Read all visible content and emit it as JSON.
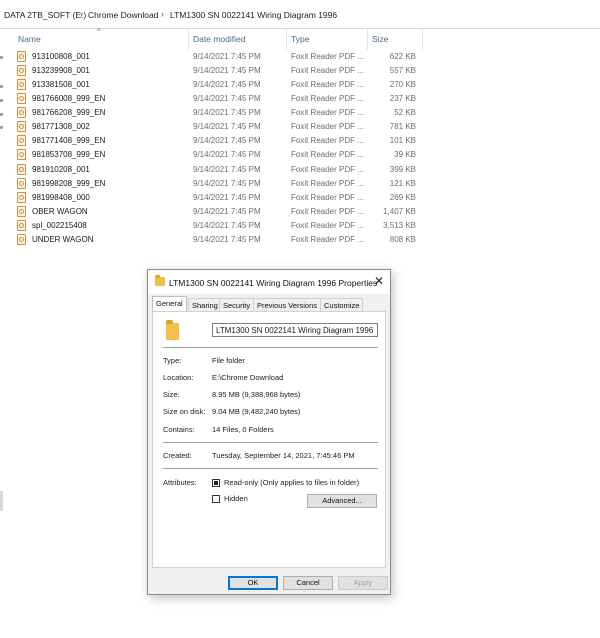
{
  "breadcrumb": [
    "DATA 2TB_SOFT (E:)",
    "Chrome Download",
    "LTM1300  SN 0022141 Wiring Diagram 1996"
  ],
  "breadcrumb_separator": "›",
  "columns": {
    "name": "Name",
    "date": "Date modified",
    "type": "Type",
    "size": "Size",
    "sort_glyph": "^"
  },
  "files": [
    {
      "name": "913100808_001",
      "date": "9/14/2021 7:45 PM",
      "type": "Foxit Reader PDF ...",
      "size": "622 KB"
    },
    {
      "name": "913239908_001",
      "date": "9/14/2021 7:45 PM",
      "type": "Foxit Reader PDF ...",
      "size": "557 KB"
    },
    {
      "name": "913381508_001",
      "date": "9/14/2021 7:45 PM",
      "type": "Foxit Reader PDF ...",
      "size": "270 KB"
    },
    {
      "name": "981766008_999_EN",
      "date": "9/14/2021 7:45 PM",
      "type": "Foxit Reader PDF ...",
      "size": "237 KB"
    },
    {
      "name": "981766208_999_EN",
      "date": "9/14/2021 7:45 PM",
      "type": "Foxit Reader PDF ...",
      "size": "52 KB"
    },
    {
      "name": "981771308_002",
      "date": "9/14/2021 7:45 PM",
      "type": "Foxit Reader PDF ...",
      "size": "781 KB"
    },
    {
      "name": "981771408_999_EN",
      "date": "9/14/2021 7:45 PM",
      "type": "Foxit Reader PDF ...",
      "size": "101 KB"
    },
    {
      "name": "981853708_999_EN",
      "date": "9/14/2021 7:45 PM",
      "type": "Foxit Reader PDF ...",
      "size": "39 KB"
    },
    {
      "name": "981910208_001",
      "date": "9/14/2021 7:45 PM",
      "type": "Foxit Reader PDF ...",
      "size": "399 KB"
    },
    {
      "name": "981998208_999_EN",
      "date": "9/14/2021 7:45 PM",
      "type": "Foxit Reader PDF ...",
      "size": "121 KB"
    },
    {
      "name": "981998408_000",
      "date": "9/14/2021 7:45 PM",
      "type": "Foxit Reader PDF ...",
      "size": "269 KB"
    },
    {
      "name": "OBER WAGON",
      "date": "9/14/2021 7:45 PM",
      "type": "Foxit Reader PDF ...",
      "size": "1,407 KB"
    },
    {
      "name": "spl_002215408",
      "date": "9/14/2021 7:45 PM",
      "type": "Foxit Reader PDF ...",
      "size": "3,513 KB"
    },
    {
      "name": "UNDER WAGON",
      "date": "9/14/2021 7:45 PM",
      "type": "Foxit Reader PDF ...",
      "size": "808 KB"
    }
  ],
  "dialog": {
    "title": "LTM1300  SN 0022141 Wiring Diagram 1996 Properties",
    "close_glyph": "✕",
    "tabs": [
      "General",
      "Sharing",
      "Security",
      "Previous Versions",
      "Customize"
    ],
    "folder_name": "LTM1300  SN 0022141 Wiring Diagram 1996",
    "type_label": "Type:",
    "type_value": "File folder",
    "location_label": "Location:",
    "location_value": "E:\\Chrome Download",
    "size_label": "Size:",
    "size_value": "8.95 MB (9,388,968 bytes)",
    "size_on_disk_label": "Size on disk:",
    "size_on_disk_value": "9.04 MB (9,482,240 bytes)",
    "contains_label": "Contains:",
    "contains_value": "14 Files, 0 Folders",
    "created_label": "Created:",
    "created_value": "Tuesday, September 14, 2021, 7:45:46 PM",
    "attributes_label": "Attributes:",
    "readonly_label": "Read-only (Only applies to files in folder)",
    "hidden_label": "Hidden",
    "advanced_label": "Advanced...",
    "ok_label": "OK",
    "cancel_label": "Cancel",
    "apply_label": "Apply",
    "colors": {
      "accent": "#0078d7",
      "folder": "#f3c14a",
      "pdf_icon": "#d48b3a"
    }
  }
}
